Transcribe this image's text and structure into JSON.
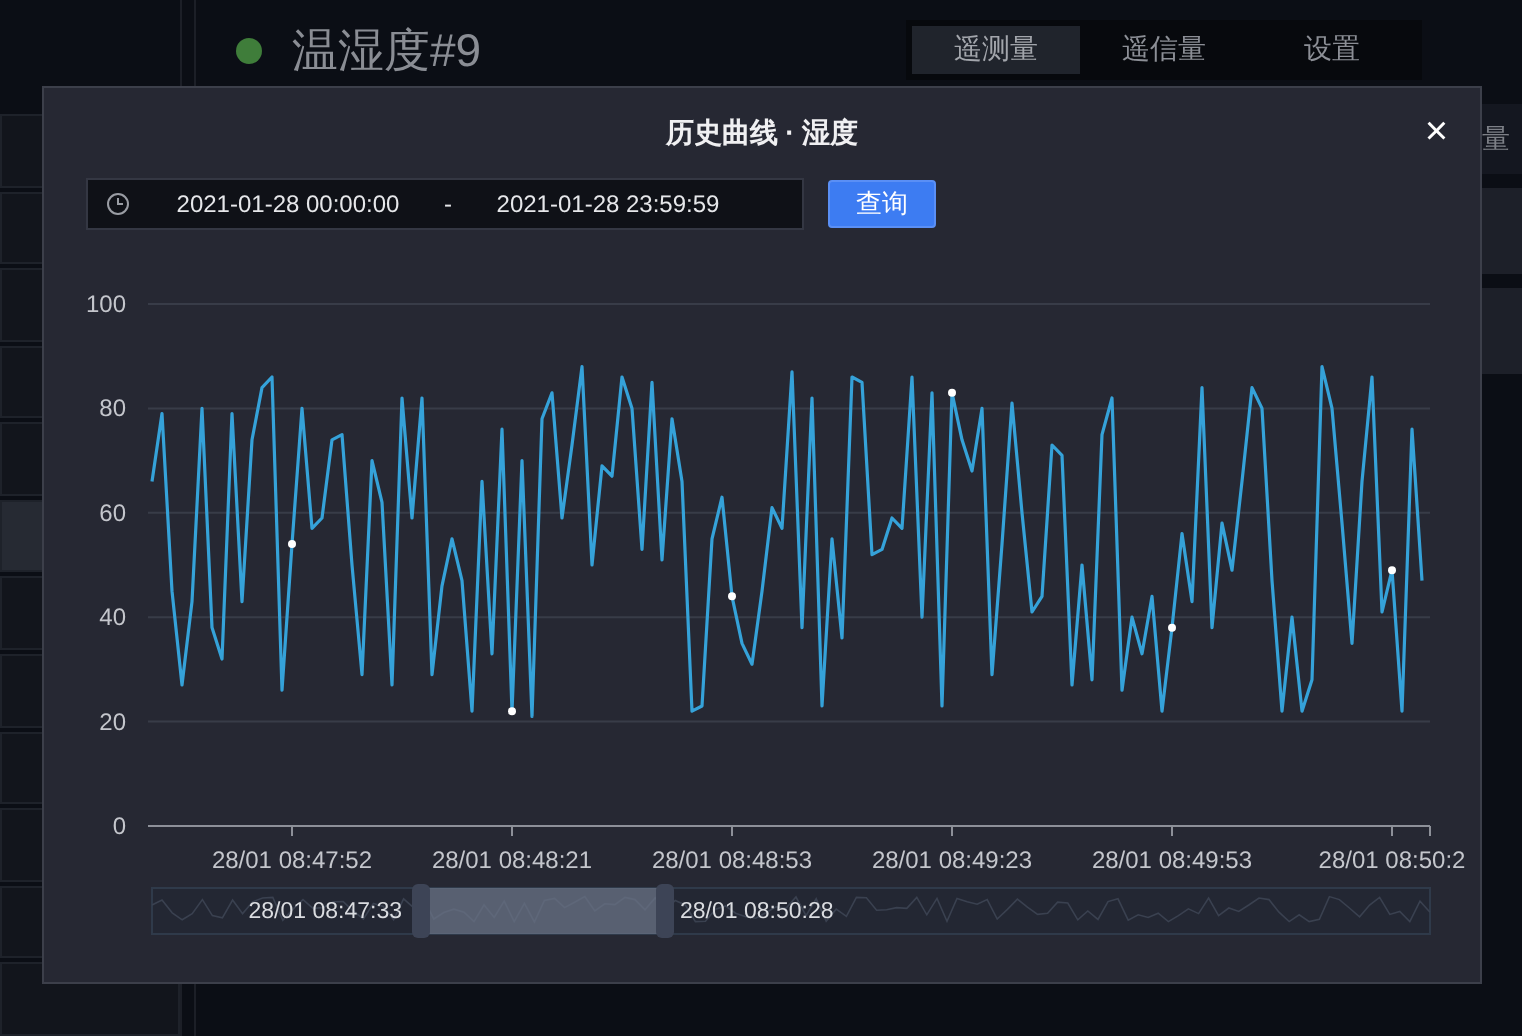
{
  "sidebar": {
    "rows": [
      {
        "selected": false
      },
      {
        "selected": false
      },
      {
        "selected": false
      },
      {
        "selected": false
      },
      {
        "selected": false
      },
      {
        "selected": true
      },
      {
        "selected": false
      },
      {
        "selected": false
      },
      {
        "selected": false
      },
      {
        "selected": false
      },
      {
        "selected": false
      },
      {
        "selected": false
      }
    ]
  },
  "device": {
    "title": "温湿度#9"
  },
  "tabs": [
    {
      "label": "遥测量",
      "selected": true
    },
    {
      "label": "遥信量",
      "selected": false
    },
    {
      "label": "设置",
      "selected": false
    }
  ],
  "background_panel": {
    "label": "量"
  },
  "dialog": {
    "title": "历史曲线 · 湿度",
    "close": "×",
    "date_range": {
      "start": "2021-01-28 00:00:00",
      "separator": "-",
      "end": "2021-01-28 23:59:59"
    },
    "query_button": "查询",
    "chart_data": {
      "type": "line",
      "grid": true,
      "ylim": [
        0,
        100
      ],
      "categories": [
        null,
        null,
        null,
        null,
        null,
        null,
        null,
        null,
        null,
        null,
        null,
        null,
        null,
        null,
        "28/01 08:47:52",
        null,
        null,
        null,
        null,
        null,
        null,
        null,
        null,
        null,
        null,
        null,
        null,
        null,
        null,
        null,
        null,
        null,
        null,
        null,
        null,
        null,
        "28/01 08:48:21",
        null,
        null,
        null,
        null,
        null,
        null,
        null,
        null,
        null,
        null,
        null,
        null,
        null,
        null,
        null,
        null,
        null,
        null,
        null,
        null,
        null,
        "28/01 08:48:53",
        null,
        null,
        null,
        null,
        null,
        null,
        null,
        null,
        null,
        null,
        null,
        null,
        null,
        null,
        null,
        null,
        null,
        null,
        null,
        null,
        null,
        "28/01 08:49:23",
        null,
        null,
        null,
        null,
        null,
        null,
        null,
        null,
        null,
        null,
        null,
        null,
        null,
        null,
        null,
        null,
        null,
        null,
        null,
        null,
        null,
        "28/01 08:49:53",
        null,
        null,
        null,
        null,
        null,
        null,
        null,
        null,
        null,
        null,
        null,
        null,
        null,
        null,
        null,
        null,
        null,
        null,
        null,
        null,
        null,
        "28/01 08:50:2",
        null,
        null,
        null
      ],
      "yticks": [
        0,
        20,
        40,
        60,
        80,
        100
      ],
      "series": [
        {
          "color": "#35a2d9",
          "values": [
            66,
            79,
            45,
            27,
            43,
            80,
            38,
            32,
            79,
            43,
            74,
            84,
            86,
            26,
            54,
            80,
            57,
            59,
            74,
            75,
            50,
            29,
            70,
            62,
            27,
            82,
            59,
            82,
            29,
            46,
            55,
            47,
            22,
            66,
            33,
            76,
            22,
            70,
            21,
            78,
            83,
            59,
            73,
            88,
            50,
            69,
            67,
            86,
            80,
            53,
            85,
            51,
            78,
            66,
            22,
            23,
            55,
            63,
            44,
            35,
            31,
            45,
            61,
            57,
            87,
            38,
            82,
            23,
            55,
            36,
            86,
            85,
            52,
            53,
            59,
            57,
            86,
            40,
            83,
            23,
            83,
            74,
            68,
            80,
            29,
            54,
            81,
            60,
            41,
            44,
            73,
            71,
            27,
            50,
            28,
            75,
            82,
            26,
            40,
            33,
            44,
            22,
            38,
            56,
            43,
            84,
            38,
            58,
            49,
            66,
            84,
            80,
            47,
            22,
            40,
            22,
            28,
            88,
            80,
            58,
            35,
            66,
            86,
            41,
            49,
            22,
            76,
            47
          ]
        }
      ]
    },
    "data_zoom": {
      "start_label": "28/01 08:47:33",
      "end_label": "28/01 08:50:28"
    }
  }
}
